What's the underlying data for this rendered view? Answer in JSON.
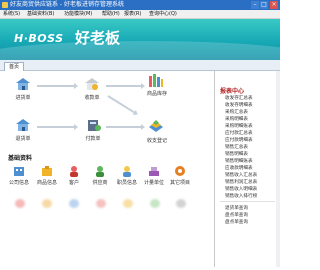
{
  "window": {
    "title": "好友商贸供应链系 - 好老板进销存管理系统",
    "controls": [
      "–",
      "□",
      "×"
    ]
  },
  "menu": [
    "系统(S)",
    "基础资料(B)",
    "功能模块(M)",
    "帮助(H)",
    "报表(R)",
    "查询中心(Q)"
  ],
  "banner": {
    "brand": "H·BOSS",
    "brand_cn": "好老板"
  },
  "tabs": [
    "首页"
  ],
  "flow": {
    "nodes": [
      "进货单",
      "收款单",
      "商品库存",
      "退货单",
      "付款单",
      "收支登记"
    ]
  },
  "base_section": {
    "title": "基础资料",
    "items": [
      "公司信息",
      "商品信息",
      "客户",
      "供应商",
      "职员信息",
      "计量单位",
      "其它项目"
    ]
  },
  "side": {
    "title": "报表中心",
    "items": [
      "收发存汇总表",
      "收发存明细表",
      "采购汇总表",
      "采购明细表",
      "采购明细账表",
      "应付款汇总表",
      "应付款明细表",
      "销售汇总表",
      "销售明细表",
      "销售明细账表",
      "应收款明细表",
      "销售收入汇总表",
      "销售利润汇总表",
      "销售收入明细表",
      "销售收入排行榜",
      "退货单查询",
      "盘点单查询",
      "盘点单查询"
    ]
  }
}
